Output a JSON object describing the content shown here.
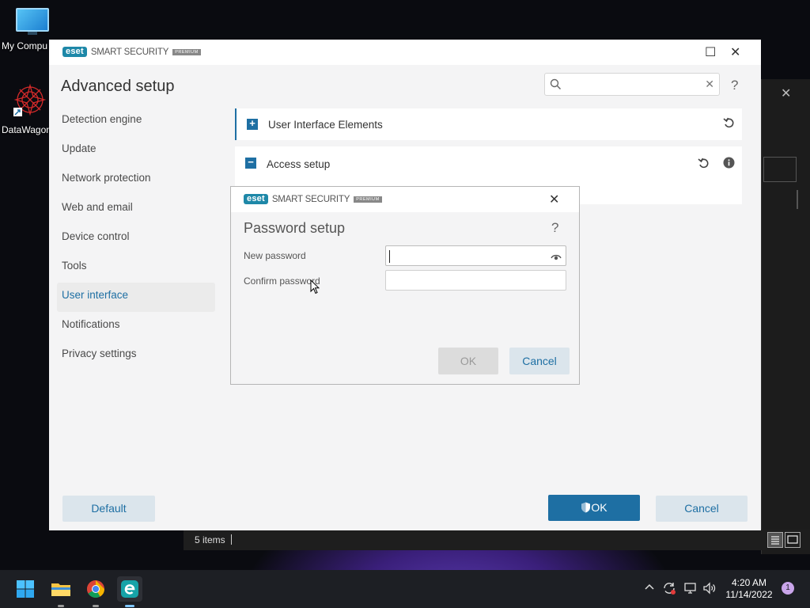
{
  "desktop": {
    "icons": [
      {
        "label": "My Compu"
      },
      {
        "label": "DataWagon"
      }
    ]
  },
  "main_window": {
    "brand": {
      "badge": "eset",
      "product": "SMART SECURITY",
      "tier": "PREMIUM"
    },
    "title": "Advanced setup",
    "search": {
      "value": "",
      "placeholder": ""
    },
    "sidebar": {
      "items": [
        {
          "label": "Detection engine"
        },
        {
          "label": "Update"
        },
        {
          "label": "Network protection"
        },
        {
          "label": "Web and email"
        },
        {
          "label": "Device control"
        },
        {
          "label": "Tools"
        },
        {
          "label": "User interface",
          "active": true
        },
        {
          "label": "Notifications"
        },
        {
          "label": "Privacy settings"
        }
      ]
    },
    "sections": [
      {
        "title": "User Interface Elements",
        "expanded": false
      },
      {
        "title": "Access setup",
        "expanded": true
      }
    ],
    "footer": {
      "default_label": "Default",
      "ok_label": "OK",
      "cancel_label": "Cancel"
    }
  },
  "dialog": {
    "brand": {
      "badge": "eset",
      "product": "SMART SECURITY",
      "tier": "PREMIUM"
    },
    "title": "Password setup",
    "fields": {
      "new_password": {
        "label": "New password",
        "value": ""
      },
      "confirm_password": {
        "label": "Confirm password",
        "value": ""
      }
    },
    "ok_label": "OK",
    "cancel_label": "Cancel"
  },
  "explorer_status": {
    "items_count": "5 items"
  },
  "taskbar": {
    "apps": [
      "start",
      "file-explorer",
      "chrome",
      "eset"
    ],
    "clock": {
      "time": "4:20 AM",
      "date": "11/14/2022"
    },
    "notification_count": "1"
  },
  "colors": {
    "accent": "#1e6fa3",
    "eset_brand": "#1e88a8"
  }
}
